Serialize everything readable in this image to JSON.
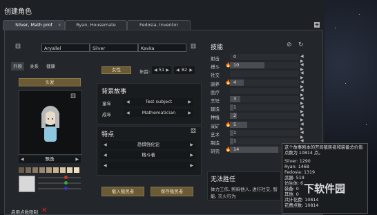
{
  "app": {
    "title": "创建角色"
  },
  "tabs": [
    {
      "label": "Silver, Math prof",
      "close": "×"
    },
    {
      "label": "Ryan, Housemate"
    },
    {
      "label": "Fedosia, Inventor"
    }
  ],
  "names": {
    "first": "Aryallel",
    "nick": "Silver",
    "last": "Kavka"
  },
  "subtabs": [
    "外貌",
    "关系",
    "健康"
  ],
  "appearance": {
    "hair_button": "头发",
    "hair_style": "飘逸",
    "gender_button": "女性",
    "age_label": "年龄:",
    "bio_age": "51",
    "chrono_age": "82"
  },
  "backstory": {
    "title": "背景故事",
    "childhood_label": "童年",
    "childhood": "Test subject",
    "adulthood_label": "成年",
    "adulthood": "Mathematician"
  },
  "traits": {
    "title": "特点",
    "items": [
      "恐惧强化论",
      "格斗者",
      ""
    ]
  },
  "incapable": {
    "title": "无法胜任",
    "text": "体力工作, 照料他人, 进行社交, 智能, 灭火行为"
  },
  "buttons": {
    "load": "载入殖民者",
    "save": "保存殖民者",
    "use_points": "启用点数限制"
  },
  "skills": {
    "title": "技能",
    "items": [
      {
        "name": "射击",
        "value": "0",
        "passion": "",
        "fill": 0
      },
      {
        "name": "搏斗",
        "value": "10",
        "passion": "🔥",
        "fill": 50
      },
      {
        "name": "社交",
        "value": "",
        "passion": "",
        "fill": 0
      },
      {
        "name": "驯养",
        "value": "4",
        "passion": "🔥",
        "fill": 20
      },
      {
        "name": "医疗",
        "value": "",
        "passion": "",
        "fill": 0
      },
      {
        "name": "烹饪",
        "value": "3",
        "passion": "",
        "fill": 15
      },
      {
        "name": "建造",
        "value": "1",
        "passion": "",
        "fill": 5
      },
      {
        "name": "种植",
        "value": "2",
        "passion": "",
        "fill": 10
      },
      {
        "name": "采矿",
        "value": "5",
        "passion": "🔥",
        "fill": 25
      },
      {
        "name": "艺术",
        "value": "1",
        "passion": "",
        "fill": 5
      },
      {
        "name": "制造",
        "value": "1",
        "passion": "",
        "fill": 5
      },
      {
        "name": "研究",
        "value": "14",
        "passion": "🔥",
        "fill": 70
      }
    ]
  },
  "tooltip": {
    "lines": [
      "这个故事剧本的开局殖民者和装备总价值点数为 10814 点。",
      "Silver: 1290",
      "Ryan: 1468",
      "Fedosia: 1319",
      "武器: 519",
      "仿生体: 6",
      "装备: 0",
      "其他: 0",
      "共计花费: 10814",
      "花费点数: 10814"
    ]
  },
  "colors": [
    "#6b5a45",
    "#7a6a55",
    "#8a7860",
    "#9a8872",
    "#b09a7d",
    "#c8b390",
    "#d8c4a0",
    "#e6d2ae",
    "#f2e0c0"
  ],
  "watermark": "下软件园"
}
